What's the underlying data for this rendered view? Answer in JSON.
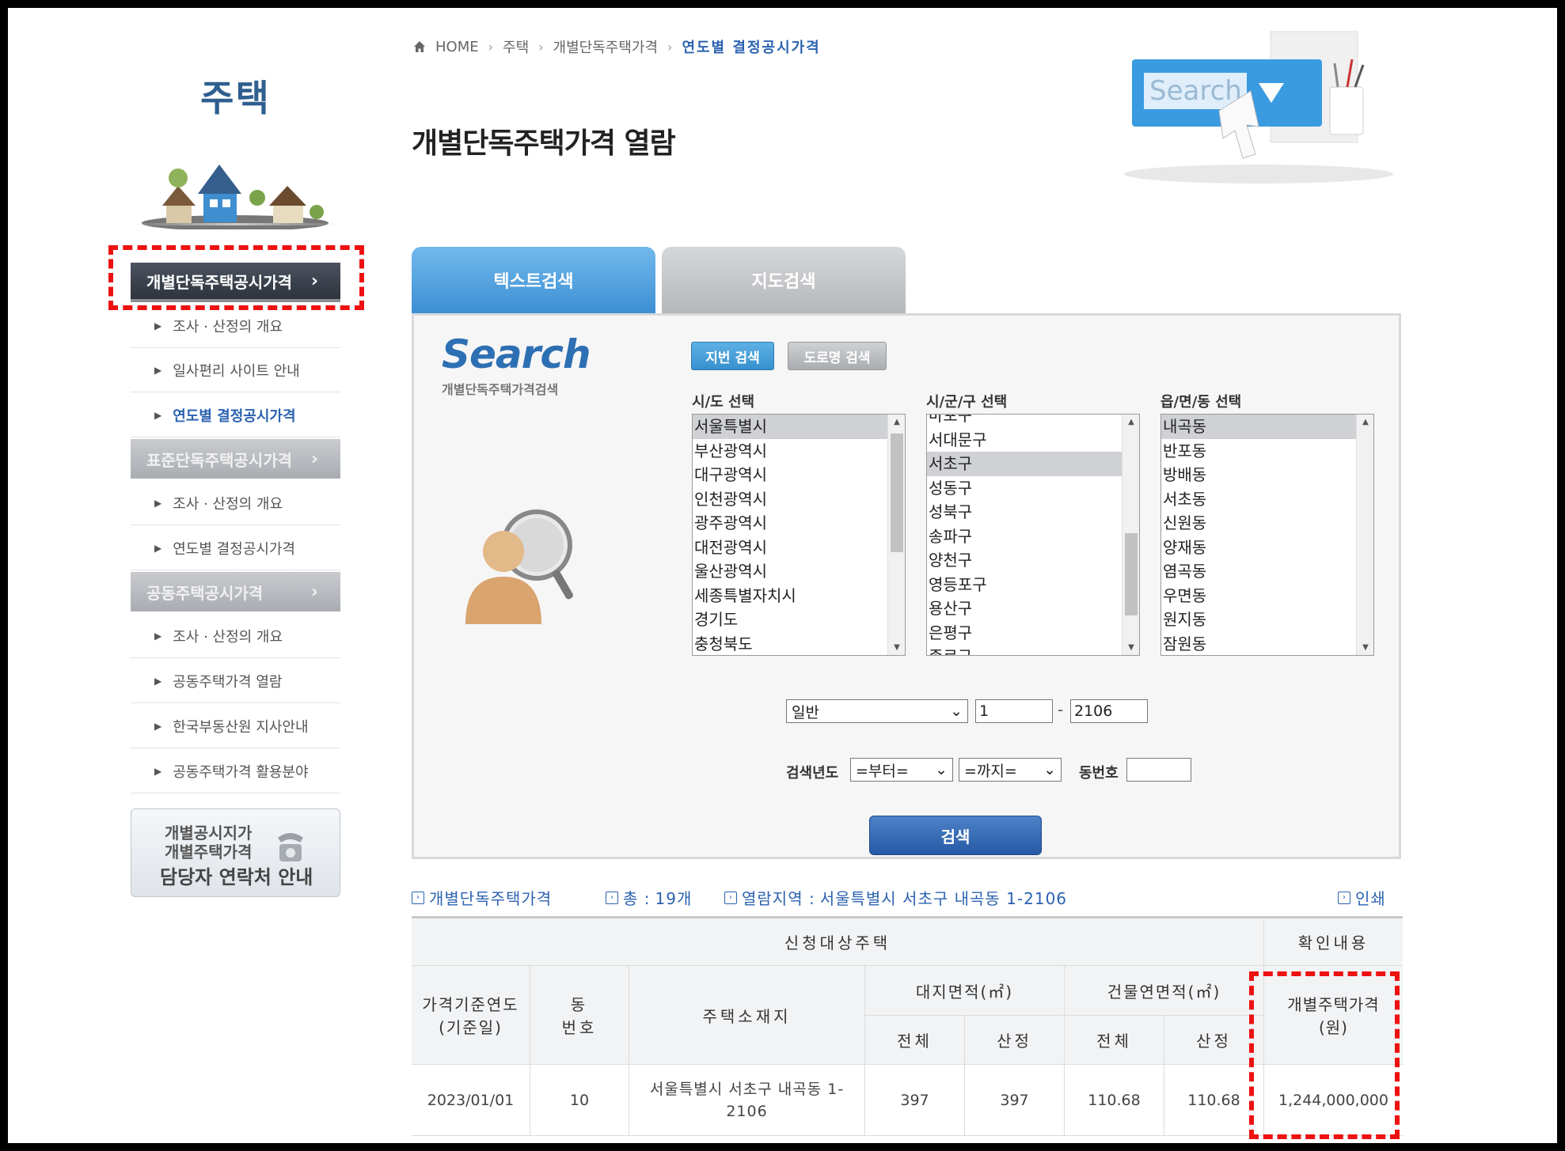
{
  "sidebar": {
    "title": "주택",
    "menu_1": {
      "label": "개별단독주택공시가격",
      "chev": "›"
    },
    "menu_1_items": [
      "조사 · 산정의 개요",
      "일사편리 사이트 안내",
      "연도별 결정공시가격"
    ],
    "menu_2": {
      "label": "표준단독주택공시가격",
      "chev": "›"
    },
    "menu_2_items": [
      "조사 · 산정의 개요",
      "연도별 결정공시가격"
    ],
    "menu_3": {
      "label": "공동주택공시가격",
      "chev": "›"
    },
    "menu_3_items": [
      "조사 · 산정의 개요",
      "공동주택가격 열람",
      "한국부동산원 지사안내",
      "공동주택가격 활용분야"
    ],
    "contact": {
      "line1": "개별공시지가",
      "line2": "개별주택가격",
      "line3": "담당자 연락처 안내"
    }
  },
  "breadcrumb": {
    "home": "HOME",
    "items": [
      "주택",
      "개별단독주택가격"
    ],
    "current": "연도별 결정공시가격"
  },
  "page_title": "개별단독주택가격 열람",
  "hero_search_text": "Search",
  "tabs": {
    "text": "텍스트검색",
    "map": "지도검색"
  },
  "search": {
    "logo": "Search",
    "logo_sub": "개별단독주택가격검색",
    "btn_jibun": "지번 검색",
    "btn_road": "도로명 검색",
    "sido": {
      "label": "시/도 선택",
      "options": [
        "서울특별시",
        "부산광역시",
        "대구광역시",
        "인천광역시",
        "광주광역시",
        "대전광역시",
        "울산광역시",
        "세종특별자치시",
        "경기도",
        "충청북도"
      ]
    },
    "sigungu": {
      "label": "시/군/구 선택",
      "options": [
        "마포구",
        "서대문구",
        "서초구",
        "성동구",
        "성북구",
        "송파구",
        "양천구",
        "영등포구",
        "용산구",
        "은평구",
        "종로구"
      ]
    },
    "emd": {
      "label": "읍/면/동 선택",
      "options": [
        "내곡동",
        "반포동",
        "방배동",
        "서초동",
        "신원동",
        "양재동",
        "염곡동",
        "우면동",
        "원지동",
        "잠원동"
      ]
    },
    "land_type": "일반",
    "bonbun": "1",
    "bubun": "2106",
    "dash": "-",
    "year_label": "검색년도",
    "year_from": "=부터=",
    "year_to": "=까지=",
    "dong_label": "동번호",
    "dong_value": "",
    "submit": "검색"
  },
  "result_info": {
    "title": "개별단독주택가격",
    "total_label": "총 :",
    "total_value": "19개",
    "region_label": "열람지역 :",
    "region_value": "서울특별시 서초구 내곡동 1-2106",
    "print": "인쇄"
  },
  "table": {
    "group_left": "신청대상주택",
    "group_right": "확인내용",
    "col_year": "가격기준연도",
    "col_year_sub": "(기준일)",
    "col_dong": "동",
    "col_dong_sub": "번호",
    "col_addr": "주택소재지",
    "col_land": "대지면적(㎡)",
    "col_bldg": "건물연면적(㎡)",
    "sub_total": "전체",
    "sub_calc": "산정",
    "col_price": "개별주택가격",
    "col_price_sub": "(원)",
    "rows": [
      {
        "year": "2023/01/01",
        "dong": "10",
        "addr_1": "서울특별시 서초구 내곡동 1-",
        "addr_2": "2106",
        "land_total": "397",
        "land_calc": "397",
        "bldg_total": "110.68",
        "bldg_calc": "110.68",
        "price": "1,244,000,000"
      }
    ]
  }
}
